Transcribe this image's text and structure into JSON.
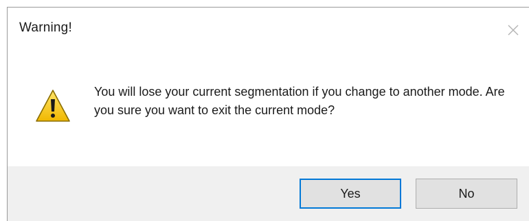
{
  "dialog": {
    "title": "Warning!",
    "icon": "warning-icon",
    "message": "You will lose your current segmentation if you change to another mode. Are you sure you want to exit the current mode?",
    "buttons": {
      "yes_label": "Yes",
      "no_label": "No"
    },
    "colors": {
      "footer_background": "#f0f0f0",
      "default_button_border": "#0078d7",
      "warning_yellow": "#f5c400"
    }
  }
}
